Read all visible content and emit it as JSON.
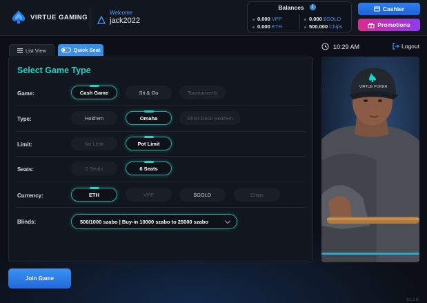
{
  "brand": {
    "name": "VIRTUE GAMING"
  },
  "user": {
    "welcome_label": "Welcome",
    "username": "jack2022"
  },
  "balances": {
    "title": "Balances",
    "info_icon": "i",
    "items": [
      {
        "amount": "0.000",
        "currency": "VPP"
      },
      {
        "amount": "0.000",
        "currency": "$GOLD"
      },
      {
        "amount": "0.000",
        "currency": "ETH"
      },
      {
        "amount": "500.000",
        "currency": "Chips"
      }
    ]
  },
  "actions": {
    "cashier_label": "Cashier",
    "promotions_label": "Promotions"
  },
  "tabs": {
    "list_view": "List View",
    "quick_seat": "Quick Seat"
  },
  "clock": {
    "time": "10:29",
    "period": "AM"
  },
  "logout_label": "Logout",
  "panel": {
    "title": "Select Game Type",
    "rows": {
      "game": {
        "label": "Game:",
        "options": [
          "Cash Game",
          "Sit & Go",
          "Tournaments"
        ],
        "selected": "Cash Game"
      },
      "type": {
        "label": "Type:",
        "options": [
          "Hold'em",
          "Omaha",
          "Short Deck Hold'em"
        ],
        "selected": "Omaha"
      },
      "limit": {
        "label": "Limit:",
        "options": [
          "No Limit",
          "Pot Limit"
        ],
        "selected": "Pot Limit"
      },
      "seats": {
        "label": "Seats:",
        "options": [
          "2 Seats",
          "6 Seats"
        ],
        "selected": "6 Seats"
      },
      "currency": {
        "label": "Currency:",
        "options": [
          "ETH",
          "VPP",
          "$GOLD",
          "Chips"
        ],
        "selected": "ETH"
      },
      "blinds": {
        "label": "Blinds:",
        "value": "500/1000 szabo | Buy-in 10000 szabo to 25000 szabo"
      }
    }
  },
  "photo": {
    "cap_text": "VIRTUE POKER"
  },
  "join_label": "Join Game",
  "version": "11.2.0",
  "colors": {
    "accent_teal": "#22d3c5",
    "primary_blue": "#2f7ff0",
    "promo_pink": "#d82c8f",
    "promo_purple": "#8d3cf0",
    "bg": "#0c0f15"
  }
}
